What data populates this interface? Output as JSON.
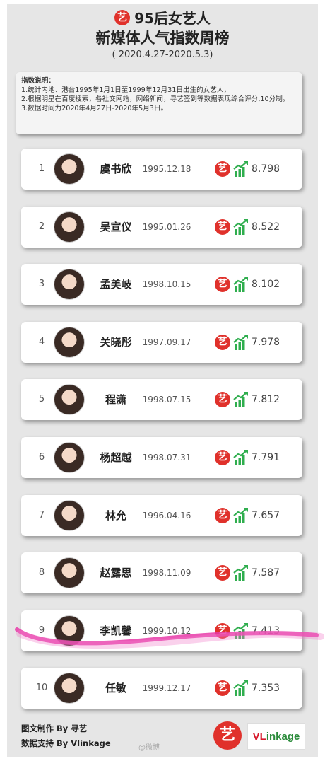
{
  "header": {
    "logo_char": "艺",
    "title_line1": "95后女艺人",
    "title_line2": "新媒体人气指数周榜",
    "date_range": "( 2020.4.27-2020.5.3)"
  },
  "notes": {
    "title": "指数说明：",
    "line1": "1.统计内地、港台1995年1月1日至1999年12月31日出生的女艺人，",
    "line2": "2.根据明星在百度搜索，各社交网站，网络新闻，寻艺签到等数据表现综合评分,10分制。",
    "line3": "3.数据时间为2020年4月27日-2020年5月3日。"
  },
  "rows": [
    {
      "rank": "1",
      "name": "虞书欣",
      "birth": "1995.12.18",
      "score": "8.798"
    },
    {
      "rank": "2",
      "name": "吴宣仪",
      "birth": "1995.01.26",
      "score": "8.522"
    },
    {
      "rank": "3",
      "name": "孟美岐",
      "birth": "1998.10.15",
      "score": "8.102"
    },
    {
      "rank": "4",
      "name": "关晓彤",
      "birth": "1997.09.17",
      "score": "7.978"
    },
    {
      "rank": "5",
      "name": "程潇",
      "birth": "1998.07.15",
      "score": "7.812"
    },
    {
      "rank": "6",
      "name": "杨超越",
      "birth": "1998.07.31",
      "score": "7.791"
    },
    {
      "rank": "7",
      "name": "林允",
      "birth": "1996.04.16",
      "score": "7.657"
    },
    {
      "rank": "8",
      "name": "赵露思",
      "birth": "1998.11.09",
      "score": "7.587"
    },
    {
      "rank": "9",
      "name": "李凯馨",
      "birth": "1999.10.12",
      "score": "7.413"
    },
    {
      "rank": "10",
      "name": "任敏",
      "birth": "1999.12.17",
      "score": "7.353"
    }
  ],
  "row_badge_char": "艺",
  "footer": {
    "credit1": "图文制作 By 寻艺",
    "credit2": "数据支持 By Vlinkage",
    "logo_char": "艺",
    "vlinkage_v": "VL",
    "vlinkage_rest": "inkage",
    "watermark": "@微博"
  },
  "colors": {
    "badge_red": "#e0312b",
    "trend_green": "#2fae4e",
    "highlight_pink": "#e83aa8"
  },
  "icons": {
    "row_badge": "yi-logo-icon",
    "trend": "trend-up-chart-icon"
  }
}
